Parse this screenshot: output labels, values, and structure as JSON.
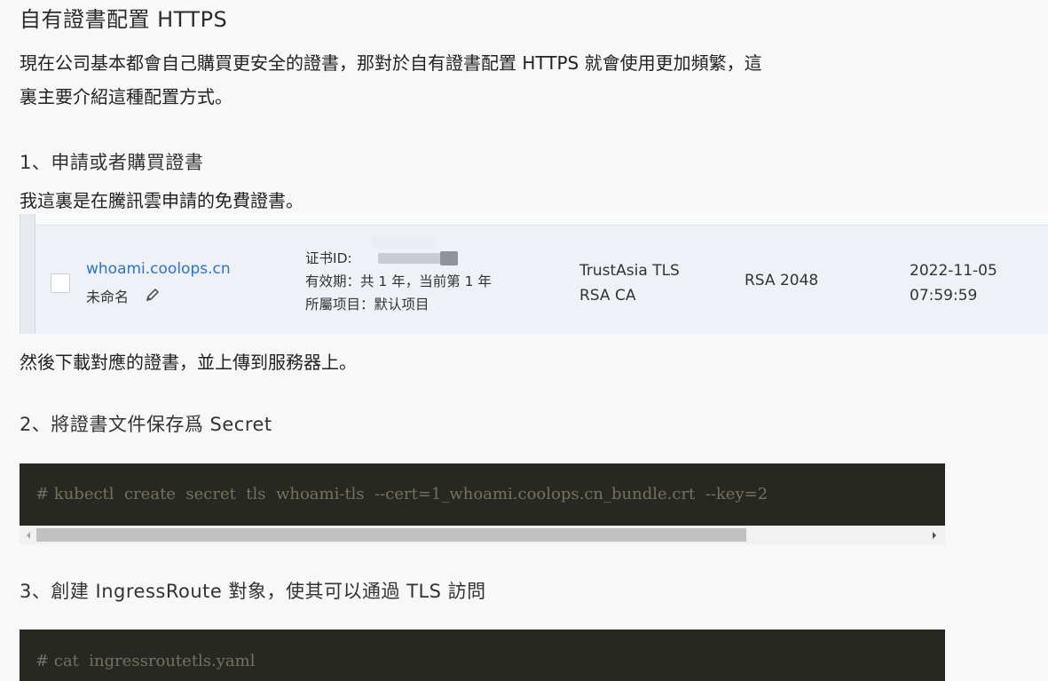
{
  "title": "自有證書配置 HTTPS",
  "intro_line1": "現在公司基本都會自己購買更安全的證書，那對於自有證書配置 HTTPS 就會使用更加頻繁，這",
  "intro_line2": "裏主要介紹這種配置方式。",
  "step1_heading": "1、申請或者購買證書",
  "step1_text": "我這裏是在騰訊雲申請的免費證書。",
  "certificate": {
    "domain": "whoami.coolops.cn",
    "name": "未命名",
    "cert_id_label": "证书ID:",
    "validity": "有效期：共 1 年，当前第 1 年",
    "project": "所屬项目：默认项目",
    "issuer_line1": "TrustAsia TLS",
    "issuer_line2": "RSA CA",
    "algorithm": "RSA 2048",
    "date": "2022-11-05",
    "time": "07:59:59"
  },
  "step1_after": "然後下載對應的證書，並上傳到服務器上。",
  "step2_heading": "2、將證書文件保存爲 Secret",
  "code1": "# kubectl  create  secret  tls  whoami-tls  --cert=1_whoami.coolops.cn_bundle.crt  --key=2",
  "step3_heading": "3、創建 IngressRoute 對象，使其可以通過 TLS 訪問",
  "code2": "# cat  ingressroutetls.yaml",
  "icons": [
    "pencil-icon",
    "scroll-left-arrow-icon",
    "scroll-right-arrow-icon"
  ]
}
